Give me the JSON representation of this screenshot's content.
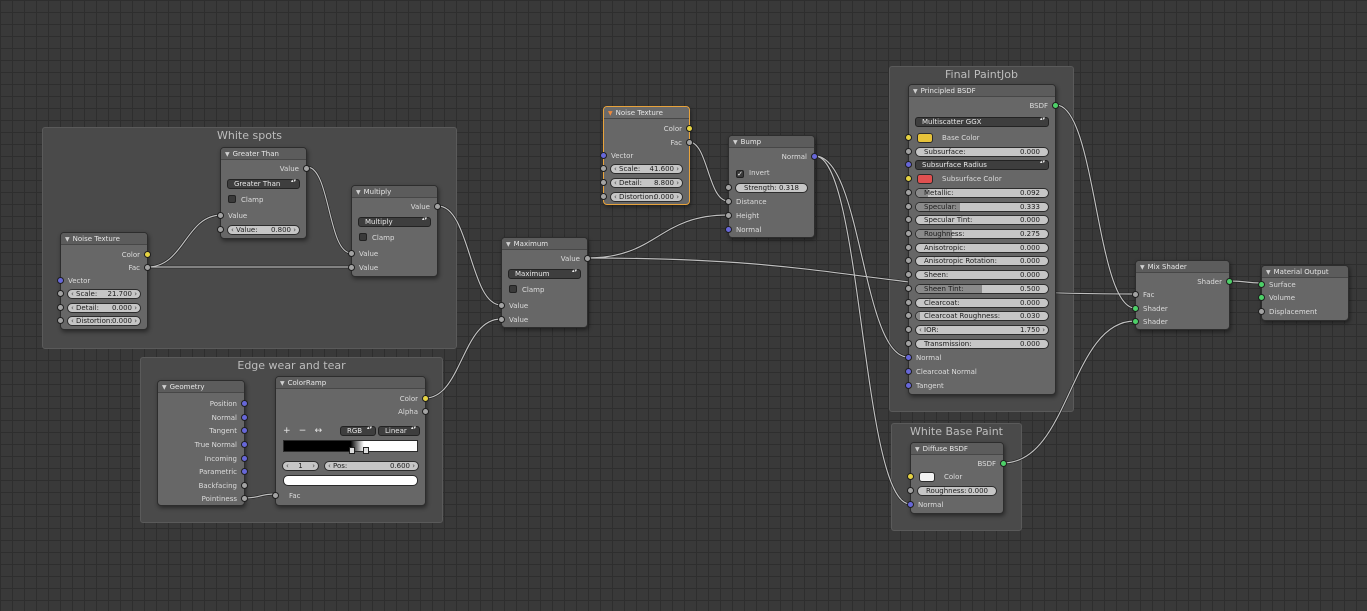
{
  "frames": {
    "white_spots": "White spots",
    "edge_wear": "Edge wear and tear",
    "final_paintjob": "Final PaintJob",
    "white_base": "White Base Paint"
  },
  "noise1": {
    "title": "Noise Texture",
    "out_color": "Color",
    "out_fac": "Fac",
    "in_vector": "Vector",
    "scale_label": "Scale:",
    "scale_value": "21.700",
    "detail_label": "Detail:",
    "detail_value": "0.000",
    "distortion_label": "Distortion:",
    "distortion_value": "0.000"
  },
  "greater_than": {
    "title": "Greater Than",
    "out_value": "Value",
    "operation": "Greater Than",
    "clamp": "Clamp",
    "in_value": "Value",
    "value_label": "Value:",
    "value_value": "0.800"
  },
  "multiply": {
    "title": "Multiply",
    "out_value": "Value",
    "operation": "Multiply",
    "clamp": "Clamp",
    "in_value_a": "Value",
    "in_value_b": "Value"
  },
  "geometry": {
    "title": "Geometry",
    "outputs": [
      "Position",
      "Normal",
      "Tangent",
      "True Normal",
      "Incoming",
      "Parametric",
      "Backfacing",
      "Pointiness"
    ]
  },
  "colorramp": {
    "title": "ColorRamp",
    "out_color": "Color",
    "out_alpha": "Alpha",
    "tool_add": "+",
    "tool_remove": "−",
    "tool_flip": "↔",
    "mode": "RGB",
    "interp": "Linear",
    "index": "1",
    "pos_label": "Pos:",
    "pos_value": "0.600",
    "in_fac": "Fac"
  },
  "maximum": {
    "title": "Maximum",
    "out_value": "Value",
    "operation": "Maximum",
    "clamp": "Clamp",
    "in_value_a": "Value",
    "in_value_b": "Value"
  },
  "noise2": {
    "title": "Noise Texture",
    "out_color": "Color",
    "out_fac": "Fac",
    "in_vector": "Vector",
    "scale_label": "Scale:",
    "scale_value": "41.600",
    "detail_label": "Detail:",
    "detail_value": "8.800",
    "distortion_label": "Distortion:",
    "distortion_value": "0.000"
  },
  "bump": {
    "title": "Bump",
    "out_normal": "Normal",
    "invert": "Invert",
    "strength_label": "Strength:",
    "strength_value": "0.318",
    "in_distance": "Distance",
    "in_height": "Height",
    "in_normal": "Normal"
  },
  "principled": {
    "title": "Principled BSDF",
    "out_bsdf": "BSDF",
    "distribution": "Multiscatter GGX",
    "base_color": "Base Color",
    "subsurface_label": "Subsurface:",
    "subsurface_value": "0.000",
    "subsurface_method": "Subsurface Radius",
    "subsurface_color": "Subsurface Color",
    "metallic_label": "Metallic:",
    "metallic_value": "0.092",
    "metallic_fill": 0.092,
    "specular_label": "Specular:",
    "specular_value": "0.333",
    "specular_fill": 0.333,
    "specular_tint_label": "Specular Tint:",
    "specular_tint_value": "0.000",
    "roughness_label": "Roughness:",
    "roughness_value": "0.275",
    "roughness_fill": 0.275,
    "anisotropic_label": "Anisotropic:",
    "anisotropic_value": "0.000",
    "aniso_rotation_label": "Anisotropic Rotation:",
    "aniso_rotation_value": "0.000",
    "sheen_label": "Sheen:",
    "sheen_value": "0.000",
    "sheen_tint_label": "Sheen Tint:",
    "sheen_tint_value": "0.500",
    "sheen_tint_fill": 0.5,
    "clearcoat_label": "Clearcoat:",
    "clearcoat_value": "0.000",
    "clearcoat_roughness_label": "Clearcoat Roughness:",
    "clearcoat_roughness_value": "0.030",
    "ior_label": "IOR:",
    "ior_value": "1.750",
    "transmission_label": "Transmission:",
    "transmission_value": "0.000",
    "in_normal": "Normal",
    "in_clearcoat_normal": "Clearcoat Normal",
    "in_tangent": "Tangent"
  },
  "diffuse": {
    "title": "Diffuse BSDF",
    "out_bsdf": "BSDF",
    "color": "Color",
    "roughness_label": "Roughness:",
    "roughness_value": "0.000",
    "in_normal": "Normal"
  },
  "mix_shader": {
    "title": "Mix Shader",
    "out_shader": "Shader",
    "in_fac": "Fac",
    "in_shader_a": "Shader",
    "in_shader_b": "Shader"
  },
  "material_output": {
    "title": "Material Output",
    "in_surface": "Surface",
    "in_volume": "Volume",
    "in_displacement": "Displacement"
  },
  "colors": {
    "base_color": "#e6c23a",
    "subsurface_color": "#e05050",
    "diffuse_color": "#f2f2f2",
    "selected_border": "#e8a33c"
  }
}
